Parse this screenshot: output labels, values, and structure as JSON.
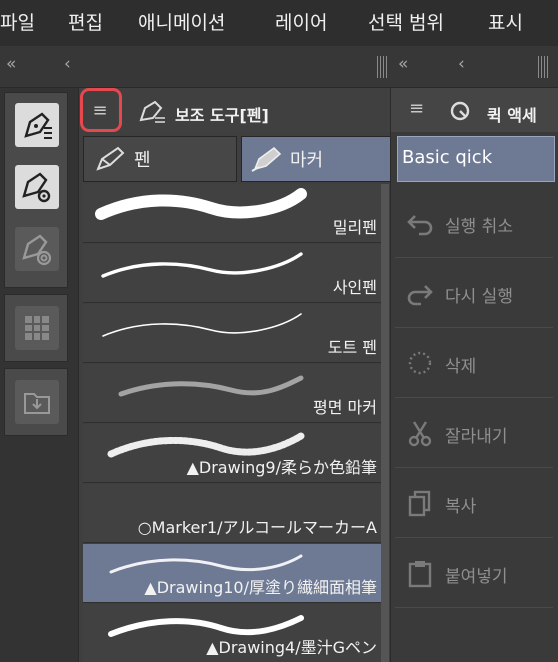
{
  "menu": [
    "파일",
    "편집",
    "애니메이션",
    "레이어",
    "선택 범위",
    "표시"
  ],
  "strip": {
    "left_collapse": "«",
    "left_back": "‹",
    "right_collapse": "«",
    "right_back": "‹"
  },
  "subtool": {
    "title": "보조 도구[펜]",
    "tabs": [
      {
        "label": "펜",
        "icon": "pen-icon",
        "selected": false
      },
      {
        "label": "마커",
        "icon": "marker-icon",
        "selected": true
      }
    ],
    "brushes": [
      {
        "label": "밀리펜",
        "stroke": "thick"
      },
      {
        "label": "사인펜",
        "stroke": "medium"
      },
      {
        "label": "도트 펜",
        "stroke": "thin"
      },
      {
        "label": "평면 마커",
        "stroke": "soft"
      },
      {
        "label": "▲Drawing9/柔らか色鉛筆",
        "stroke": "pencil"
      },
      {
        "label": "○Marker1/アルコールマーカーA",
        "stroke": "none"
      },
      {
        "label": "▲Drawing10/厚塗り繊細面相筆",
        "stroke": "paint"
      },
      {
        "label": "▲Drawing4/墨汁Gペン",
        "stroke": "ink"
      }
    ],
    "selected_index": 6
  },
  "quick": {
    "title": "퀵 액세",
    "set": "Basic qick",
    "items": [
      {
        "label": "실행 취소",
        "icon": "undo-icon"
      },
      {
        "label": "다시 실행",
        "icon": "redo-icon"
      },
      {
        "label": "삭제",
        "icon": "delete-icon"
      },
      {
        "label": "잘라내기",
        "icon": "scissors-icon"
      },
      {
        "label": "복사",
        "icon": "copy-icon"
      },
      {
        "label": "붙여넣기",
        "icon": "paste-icon"
      }
    ]
  },
  "colors": {
    "accent": "#6e7a94",
    "highlight": "#e5484d"
  }
}
